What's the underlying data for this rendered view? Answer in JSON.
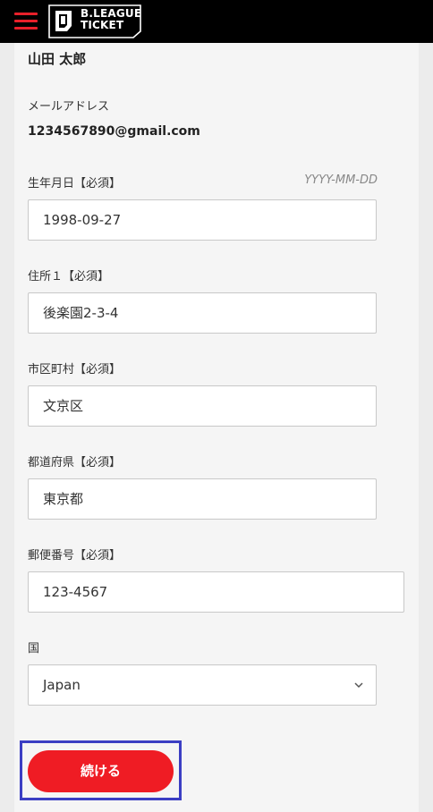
{
  "header": {
    "logo_line1": "B.LEAGUE",
    "logo_line2": "TICKET"
  },
  "profile": {
    "name": "山田 太郎",
    "email_label": "メールアドレス",
    "email_value": "1234567890@gmail.com"
  },
  "form": {
    "birthdate": {
      "label": "生年月日【必須】",
      "hint": "YYYY-MM-DD",
      "value": "1998-09-27"
    },
    "address1": {
      "label": "住所１【必須】",
      "value": "後楽園2-3-4"
    },
    "city": {
      "label": "市区町村【必須】",
      "value": "文京区"
    },
    "prefecture": {
      "label": "都道府県【必須】",
      "value": "東京都"
    },
    "postal_code": {
      "label": "郵便番号【必須】",
      "value": "123-4567"
    },
    "country": {
      "label": "国",
      "selected": "Japan"
    }
  },
  "actions": {
    "continue_label": "続ける"
  },
  "colors": {
    "accent": "#ef1c24",
    "header_bg": "#000000",
    "highlight": "#3b3ec3"
  }
}
